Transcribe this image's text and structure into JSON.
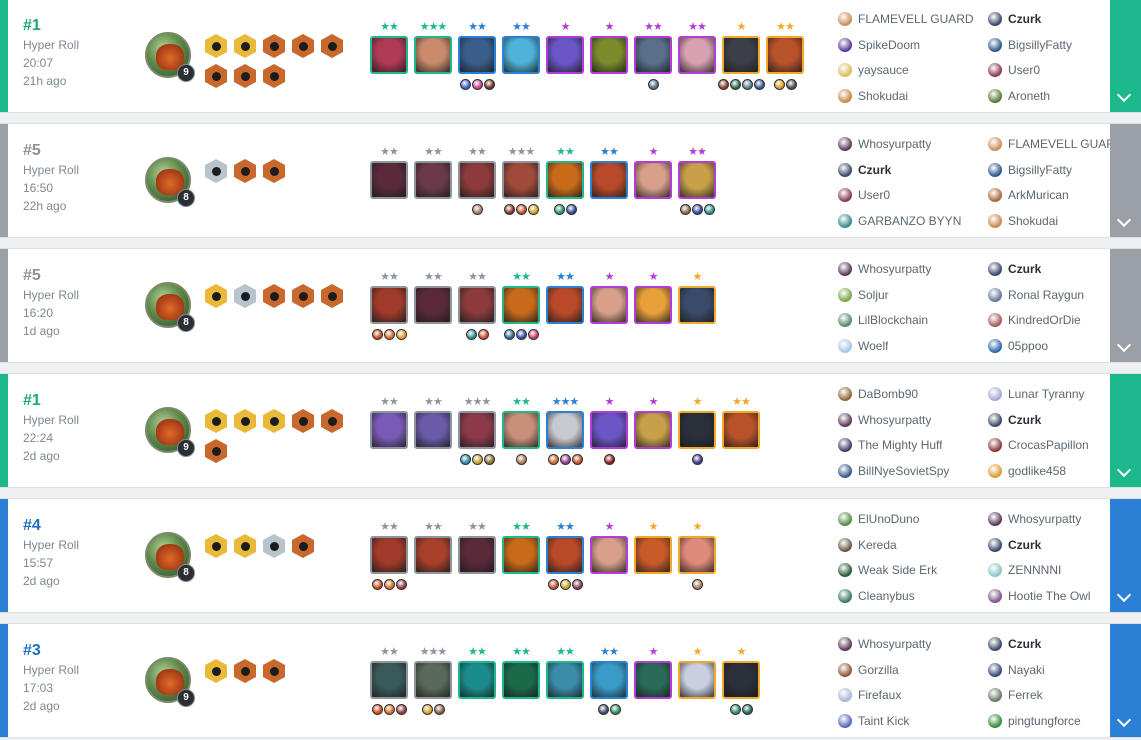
{
  "colors": {
    "first": "#1db88c",
    "top4": "#2b7fd4",
    "bottom": "#9aa0a6",
    "first_text": "#1ba67e",
    "top4_text": "#1f6fbf",
    "bottom_text": "#8a929a",
    "star_gray": "#8d969e",
    "star_teal": "#1db88c",
    "star_blue": "#2b7fd4",
    "star_purple": "#b33cd8",
    "star_gold": "#f0a92a",
    "cost1": "#8d969e",
    "cost2": "#1db88c",
    "cost3": "#2b7fd4",
    "cost4": "#b33cd8",
    "cost5": "#f0a92a"
  },
  "matches": [
    {
      "placement": "#1",
      "tier": "first",
      "mode": "Hyper Roll",
      "time": "20:07",
      "ago": "21h ago",
      "level": "9",
      "traits": [
        "gold",
        "gold",
        "bronze",
        "bronze",
        "bronze",
        "bronze",
        "bronze",
        "bronze"
      ],
      "units": [
        {
          "stars": "★★",
          "star_color": "star_teal",
          "cost": "cost2",
          "face": "#b03a55",
          "items": []
        },
        {
          "stars": "★★★",
          "star_color": "star_teal",
          "cost": "cost2",
          "face": "#c98b6b",
          "items": []
        },
        {
          "stars": "★★",
          "star_color": "star_blue",
          "cost": "cost3",
          "face": "#3a5e8c",
          "items": [
            "#3d5fc7",
            "#c83f86",
            "#6b2e20"
          ]
        },
        {
          "stars": "★★",
          "star_color": "star_blue",
          "cost": "cost3",
          "face": "#4fb3d9",
          "items": []
        },
        {
          "stars": "★",
          "star_color": "star_purple",
          "cost": "cost4",
          "face": "#6a56c6",
          "items": []
        },
        {
          "stars": "★",
          "star_color": "star_purple",
          "cost": "cost4",
          "face": "#7b8a2a",
          "items": []
        },
        {
          "stars": "★★",
          "star_color": "star_purple",
          "cost": "cost4",
          "face": "#59708a",
          "items": [
            "#4a6c8c"
          ]
        },
        {
          "stars": "★★",
          "star_color": "star_purple",
          "cost": "cost4",
          "face": "#d7a1b0",
          "items": []
        },
        {
          "stars": "★",
          "star_color": "star_gold",
          "cost": "cost5",
          "face": "#3b3f46",
          "items": [
            "#8c3b2a",
            "#2f6b4a",
            "#5d7a8c",
            "#355a8c"
          ]
        },
        {
          "stars": "★★",
          "star_color": "star_gold",
          "cost": "cost5",
          "face": "#b8522a",
          "items": [
            "#d69a2a",
            "#4a4a4a"
          ]
        }
      ],
      "players": [
        {
          "name": "FLAMEVELL GUARD",
          "me": false,
          "pic": "#c8915a"
        },
        {
          "name": "Czurk",
          "me": true,
          "pic": "#3b4a6b"
        },
        {
          "name": "SpikeDoom",
          "me": false,
          "pic": "#5d3a9c"
        },
        {
          "name": "BigsillyFatty",
          "me": false,
          "pic": "#2d5a8c"
        },
        {
          "name": "yaysauce",
          "me": false,
          "pic": "#d8c05a"
        },
        {
          "name": "User0",
          "me": false,
          "pic": "#8c3a5a"
        },
        {
          "name": "Shokudai",
          "me": false,
          "pic": "#c88a4a"
        },
        {
          "name": "Aroneth",
          "me": false,
          "pic": "#5a7a3a"
        }
      ]
    },
    {
      "placement": "#5",
      "tier": "bottom",
      "mode": "Hyper Roll",
      "time": "16:50",
      "ago": "22h ago",
      "level": "8",
      "traits": [
        "silver",
        "bronze",
        "bronze"
      ],
      "units": [
        {
          "stars": "★★",
          "star_color": "star_gray",
          "cost": "cost1",
          "face": "#5a2a3a",
          "items": []
        },
        {
          "stars": "★★",
          "star_color": "star_gray",
          "cost": "cost1",
          "face": "#6a3a4a",
          "items": []
        },
        {
          "stars": "★★",
          "star_color": "star_gray",
          "cost": "cost1",
          "face": "#8c3a3a",
          "items": [
            "#a87a5a"
          ]
        },
        {
          "stars": "★★★",
          "star_color": "star_gray",
          "cost": "cost1",
          "face": "#a04a3a",
          "items": [
            "#8c2a2a",
            "#c84a2a",
            "#c8a02a"
          ]
        },
        {
          "stars": "★★",
          "star_color": "star_teal",
          "cost": "cost2",
          "face": "#c86a1a",
          "items": [
            "#2a8c6a",
            "#2a4a8c"
          ]
        },
        {
          "stars": "★★",
          "star_color": "star_blue",
          "cost": "cost3",
          "face": "#b84a2a",
          "items": []
        },
        {
          "stars": "★",
          "star_color": "star_purple",
          "cost": "cost4",
          "face": "#d8a08a",
          "items": []
        },
        {
          "stars": "★★",
          "star_color": "star_purple",
          "cost": "cost4",
          "face": "#c8a04a",
          "items": [
            "#8a6a4a",
            "#2a4aa8",
            "#2a8c8c"
          ]
        }
      ],
      "players": [
        {
          "name": "Whosyurpatty",
          "me": false,
          "pic": "#5a3a5a"
        },
        {
          "name": "FLAMEVELL GUARD",
          "me": false,
          "pic": "#c8915a"
        },
        {
          "name": "Czurk",
          "me": true,
          "pic": "#3b4a6b"
        },
        {
          "name": "BigsillyFatty",
          "me": false,
          "pic": "#2d5a8c"
        },
        {
          "name": "User0",
          "me": false,
          "pic": "#8c3a5a"
        },
        {
          "name": "ArkMurican",
          "me": false,
          "pic": "#a86a3a"
        },
        {
          "name": "GARBANZO BYYN",
          "me": false,
          "pic": "#3a8c8c"
        },
        {
          "name": "Shokudai",
          "me": false,
          "pic": "#c88a4a"
        }
      ]
    },
    {
      "placement": "#5",
      "tier": "bottom",
      "mode": "Hyper Roll",
      "time": "16:20",
      "ago": "1d ago",
      "level": "8",
      "traits": [
        "gold",
        "silver",
        "bronze",
        "bronze",
        "bronze"
      ],
      "units": [
        {
          "stars": "★★",
          "star_color": "star_gray",
          "cost": "cost1",
          "face": "#a03a2a",
          "items": [
            "#c84a1a",
            "#d86a2a",
            "#e89a2a"
          ]
        },
        {
          "stars": "★★",
          "star_color": "star_gray",
          "cost": "cost1",
          "face": "#5a2a3a",
          "items": []
        },
        {
          "stars": "★★",
          "star_color": "star_gray",
          "cost": "cost1",
          "face": "#8c3a3a",
          "items": [
            "#2a8c8c",
            "#c84a2a"
          ]
        },
        {
          "stars": "★★",
          "star_color": "star_teal",
          "cost": "cost2",
          "face": "#c86a1a",
          "items": [
            "#2a6a8c",
            "#3a4aa8",
            "#c83a6a"
          ]
        },
        {
          "stars": "★★",
          "star_color": "star_blue",
          "cost": "cost3",
          "face": "#b84a2a",
          "items": []
        },
        {
          "stars": "★",
          "star_color": "star_purple",
          "cost": "cost4",
          "face": "#d8a08a",
          "items": []
        },
        {
          "stars": "★",
          "star_color": "star_purple",
          "cost": "cost4",
          "face": "#e8a03a",
          "items": []
        },
        {
          "stars": "★",
          "star_color": "star_gold",
          "cost": "cost5",
          "face": "#3a4a6a",
          "items": []
        }
      ],
      "players": [
        {
          "name": "Whosyurpatty",
          "me": false,
          "pic": "#5a3a5a"
        },
        {
          "name": "Czurk",
          "me": true,
          "pic": "#3b4a6b"
        },
        {
          "name": "Soljur",
          "me": false,
          "pic": "#7aa84a"
        },
        {
          "name": "Ronal Raygun",
          "me": false,
          "pic": "#6a7a9a"
        },
        {
          "name": "LilBlockchain",
          "me": false,
          "pic": "#5a8c6a"
        },
        {
          "name": "KindredOrDie",
          "me": false,
          "pic": "#a85a5a"
        },
        {
          "name": "Woelf",
          "me": false,
          "pic": "#a8c8e8"
        },
        {
          "name": "05ppoo",
          "me": false,
          "pic": "#2a6aa8"
        }
      ]
    },
    {
      "placement": "#1",
      "tier": "first",
      "mode": "Hyper Roll",
      "time": "22:24",
      "ago": "2d ago",
      "level": "9",
      "traits": [
        "gold",
        "gold",
        "gold",
        "bronze",
        "bronze",
        "bronze"
      ],
      "units": [
        {
          "stars": "★★",
          "star_color": "star_gray",
          "cost": "cost1",
          "face": "#7a5ab8",
          "items": []
        },
        {
          "stars": "★★",
          "star_color": "star_gray",
          "cost": "cost1",
          "face": "#6a5aa8",
          "items": []
        },
        {
          "stars": "★★★",
          "star_color": "star_gray",
          "cost": "cost1",
          "face": "#8c3a4a",
          "items": [
            "#2a8ca8",
            "#c8a02a",
            "#8c6a2a"
          ]
        },
        {
          "stars": "★★",
          "star_color": "star_teal",
          "cost": "cost2",
          "face": "#c8907a",
          "items": [
            "#a87a5a"
          ]
        },
        {
          "stars": "★★★",
          "star_color": "star_blue",
          "cost": "cost3",
          "face": "#c8c8d0",
          "items": [
            "#c86a2a",
            "#8c3a8c",
            "#c84a2a"
          ]
        },
        {
          "stars": "★",
          "star_color": "star_purple",
          "cost": "cost4",
          "face": "#6a56c6",
          "items": [
            "#8c1a1a"
          ]
        },
        {
          "stars": "★",
          "star_color": "star_purple",
          "cost": "cost4",
          "face": "#c8a04a",
          "items": []
        },
        {
          "stars": "★",
          "star_color": "star_gold",
          "cost": "cost5",
          "face": "#2a2f3a",
          "items": [
            "#3a3a8c"
          ]
        },
        {
          "stars": "★★",
          "star_color": "star_gold",
          "cost": "cost5",
          "face": "#b8522a",
          "items": []
        }
      ],
      "players": [
        {
          "name": "DaBomb90",
          "me": false,
          "pic": "#8c6a3a"
        },
        {
          "name": "Lunar Tyranny",
          "me": false,
          "pic": "#a8a8d8"
        },
        {
          "name": "Whosyurpatty",
          "me": false,
          "pic": "#5a3a5a"
        },
        {
          "name": "Czurk",
          "me": true,
          "pic": "#3b4a6b"
        },
        {
          "name": "The Mighty Huff",
          "me": false,
          "pic": "#4a3a6a"
        },
        {
          "name": "CrocasPapillon",
          "me": false,
          "pic": "#8c3a3a"
        },
        {
          "name": "BillNyeSovietSpy",
          "me": false,
          "pic": "#3a5a8c"
        },
        {
          "name": "godlike458",
          "me": false,
          "pic": "#d8a03a"
        }
      ]
    },
    {
      "placement": "#4",
      "tier": "top4",
      "mode": "Hyper Roll",
      "time": "15:57",
      "ago": "2d ago",
      "level": "8",
      "traits": [
        "gold",
        "gold",
        "silver",
        "bronze"
      ],
      "units": [
        {
          "stars": "★★",
          "star_color": "star_gray",
          "cost": "cost1",
          "face": "#a03a2a",
          "items": [
            "#c84a1a",
            "#d86a2a",
            "#8c3a3a"
          ]
        },
        {
          "stars": "★★",
          "star_color": "star_gray",
          "cost": "cost1",
          "face": "#a8402a",
          "items": []
        },
        {
          "stars": "★★",
          "star_color": "star_gray",
          "cost": "cost1",
          "face": "#5a2a3a",
          "items": []
        },
        {
          "stars": "★★",
          "star_color": "star_teal",
          "cost": "cost2",
          "face": "#c86a1a",
          "items": []
        },
        {
          "stars": "★★",
          "star_color": "star_blue",
          "cost": "cost3",
          "face": "#b84a2a",
          "items": [
            "#c84a2a",
            "#c8a02a",
            "#8c3a5a"
          ]
        },
        {
          "stars": "★",
          "star_color": "star_purple",
          "cost": "cost4",
          "face": "#d8a08a",
          "items": []
        },
        {
          "stars": "★",
          "star_color": "star_gold",
          "cost": "cost5",
          "face": "#c85a2a",
          "items": []
        },
        {
          "stars": "★",
          "star_color": "star_gold",
          "cost": "cost5",
          "face": "#e08a7a",
          "items": [
            "#a87a5a"
          ]
        }
      ],
      "players": [
        {
          "name": "ElUnoDuno",
          "me": false,
          "pic": "#5a8c4a"
        },
        {
          "name": "Whosyurpatty",
          "me": false,
          "pic": "#5a3a5a"
        },
        {
          "name": "Kereda",
          "me": false,
          "pic": "#6a5a4a"
        },
        {
          "name": "Czurk",
          "me": true,
          "pic": "#3b4a6b"
        },
        {
          "name": "Weak Side Erk",
          "me": false,
          "pic": "#2a5a3a"
        },
        {
          "name": "ZENNNNI",
          "me": false,
          "pic": "#8cc8c8"
        },
        {
          "name": "Cleanybus",
          "me": false,
          "pic": "#3a7a6a"
        },
        {
          "name": "Hootie The Owl",
          "me": false,
          "pic": "#7a5a8c"
        }
      ]
    },
    {
      "placement": "#3",
      "tier": "top4",
      "mode": "Hyper Roll",
      "time": "17:03",
      "ago": "2d ago",
      "level": "9",
      "traits": [
        "gold",
        "bronze",
        "bronze"
      ],
      "units": [
        {
          "stars": "★★",
          "star_color": "star_gray",
          "cost": "cost1",
          "face": "#3a5a5a",
          "items": [
            "#c84a1a",
            "#d86a2a",
            "#8c3a3a"
          ]
        },
        {
          "stars": "★★★",
          "star_color": "star_gray",
          "cost": "cost1",
          "face": "#5a6a5a",
          "items": [
            "#d8a02a",
            "#8c5a3a"
          ]
        },
        {
          "stars": "★★",
          "star_color": "star_teal",
          "cost": "cost2",
          "face": "#1a8c8c",
          "items": []
        },
        {
          "stars": "★★",
          "star_color": "star_teal",
          "cost": "cost2",
          "face": "#1a6a4a",
          "items": []
        },
        {
          "stars": "★★",
          "star_color": "star_teal",
          "cost": "cost2",
          "face": "#3a8ca8",
          "items": []
        },
        {
          "stars": "★★",
          "star_color": "star_blue",
          "cost": "cost3",
          "face": "#3a9ac8",
          "items": [
            "#3a4a6a",
            "#2a8c5a"
          ]
        },
        {
          "stars": "★",
          "star_color": "star_purple",
          "cost": "cost4",
          "face": "#2a6a5a",
          "items": []
        },
        {
          "stars": "★",
          "star_color": "star_gold",
          "cost": "cost5",
          "face": "#c8d0e0",
          "items": []
        },
        {
          "stars": "★",
          "star_color": "star_gold",
          "cost": "cost5",
          "face": "#2a2f3a",
          "items": [
            "#2a8c6a",
            "#1a6a5a"
          ]
        }
      ],
      "players": [
        {
          "name": "Whosyurpatty",
          "me": false,
          "pic": "#5a3a5a"
        },
        {
          "name": "Czurk",
          "me": true,
          "pic": "#3b4a6b"
        },
        {
          "name": "Gorzilla",
          "me": false,
          "pic": "#8c5a3a"
        },
        {
          "name": "Nayaki",
          "me": false,
          "pic": "#3a4a7a"
        },
        {
          "name": "Firefaux",
          "me": false,
          "pic": "#a8b8d8"
        },
        {
          "name": "Ferrek",
          "me": false,
          "pic": "#6a7a6a"
        },
        {
          "name": "Taint Kick",
          "me": false,
          "pic": "#5a6ab8"
        },
        {
          "name": "pingtungforce",
          "me": false,
          "pic": "#3a8c3a"
        }
      ]
    }
  ]
}
